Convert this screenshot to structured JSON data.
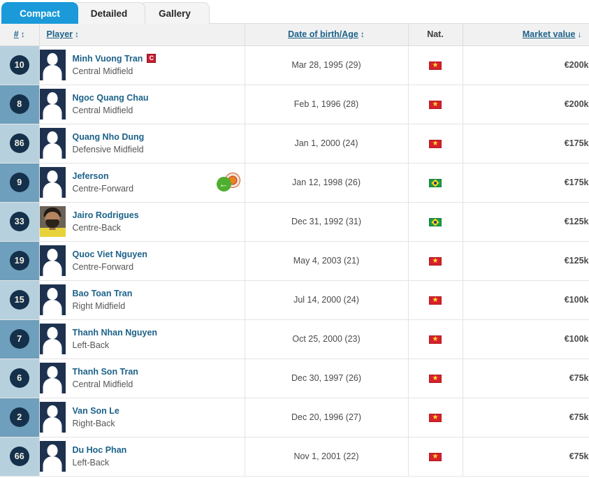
{
  "tabs": [
    {
      "label": "Compact",
      "active": true
    },
    {
      "label": "Detailed",
      "active": false
    },
    {
      "label": "Gallery",
      "active": false
    }
  ],
  "columns": {
    "number": "#",
    "player": "Player",
    "dob": "Date of birth/Age",
    "nat": "Nat.",
    "market_value": "Market value"
  },
  "sort_glyphs": {
    "both": "↕",
    "desc": "↓"
  },
  "sort_state": {
    "column": "Market value",
    "direction": "desc"
  },
  "icons": {
    "captain": "C",
    "loan_arrow": "←",
    "avatar_placeholder": "silhouette-avatar-icon"
  },
  "colors": {
    "active_tab": "#1a9ad9",
    "link": "#1c6289",
    "number_badge": "#15304a",
    "row_shade_light": "#b6d0de",
    "row_shade_dark": "#6e9fbc",
    "captain_badge": "#c81e32",
    "loan_arrow": "#4fae2f"
  },
  "rows": [
    {
      "number": "10",
      "name": "Minh Vuong Tran",
      "position": "Central Midfield",
      "captain": true,
      "loan": false,
      "photo": false,
      "dob": "Mar 28, 1995 (29)",
      "nationality": "Vietnam",
      "flag": "vn",
      "market_value": "€200k"
    },
    {
      "number": "8",
      "name": "Ngoc Quang Chau",
      "position": "Central Midfield",
      "captain": false,
      "loan": false,
      "photo": false,
      "dob": "Feb 1, 1996 (28)",
      "nationality": "Vietnam",
      "flag": "vn",
      "market_value": "€200k"
    },
    {
      "number": "86",
      "name": "Quang Nho Dung",
      "position": "Defensive Midfield",
      "captain": false,
      "loan": false,
      "photo": false,
      "dob": "Jan 1, 2000 (24)",
      "nationality": "Vietnam",
      "flag": "vn",
      "market_value": "€175k"
    },
    {
      "number": "9",
      "name": "Jeferson",
      "position": "Centre-Forward",
      "captain": false,
      "loan": true,
      "photo": false,
      "dob": "Jan 12, 1998 (26)",
      "nationality": "Brazil",
      "flag": "br",
      "market_value": "€175k"
    },
    {
      "number": "33",
      "name": "Jairo Rodrigues",
      "position": "Centre-Back",
      "captain": false,
      "loan": false,
      "photo": true,
      "dob": "Dec 31, 1992 (31)",
      "nationality": "Brazil",
      "flag": "br",
      "market_value": "€125k"
    },
    {
      "number": "19",
      "name": "Quoc Viet Nguyen",
      "position": "Centre-Forward",
      "captain": false,
      "loan": false,
      "photo": false,
      "dob": "May 4, 2003 (21)",
      "nationality": "Vietnam",
      "flag": "vn",
      "market_value": "€125k"
    },
    {
      "number": "15",
      "name": "Bao Toan Tran",
      "position": "Right Midfield",
      "captain": false,
      "loan": false,
      "photo": false,
      "dob": "Jul 14, 2000 (24)",
      "nationality": "Vietnam",
      "flag": "vn",
      "market_value": "€100k"
    },
    {
      "number": "7",
      "name": "Thanh Nhan Nguyen",
      "position": "Left-Back",
      "captain": false,
      "loan": false,
      "photo": false,
      "dob": "Oct 25, 2000 (23)",
      "nationality": "Vietnam",
      "flag": "vn",
      "market_value": "€100k"
    },
    {
      "number": "6",
      "name": "Thanh Son Tran",
      "position": "Central Midfield",
      "captain": false,
      "loan": false,
      "photo": false,
      "dob": "Dec 30, 1997 (26)",
      "nationality": "Vietnam",
      "flag": "vn",
      "market_value": "€75k"
    },
    {
      "number": "2",
      "name": "Van Son Le",
      "position": "Right-Back",
      "captain": false,
      "loan": false,
      "photo": false,
      "dob": "Dec 20, 1996 (27)",
      "nationality": "Vietnam",
      "flag": "vn",
      "market_value": "€75k"
    },
    {
      "number": "66",
      "name": "Du Hoc Phan",
      "position": "Left-Back",
      "captain": false,
      "loan": false,
      "photo": false,
      "dob": "Nov 1, 2001 (22)",
      "nationality": "Vietnam",
      "flag": "vn",
      "market_value": "€75k"
    }
  ]
}
